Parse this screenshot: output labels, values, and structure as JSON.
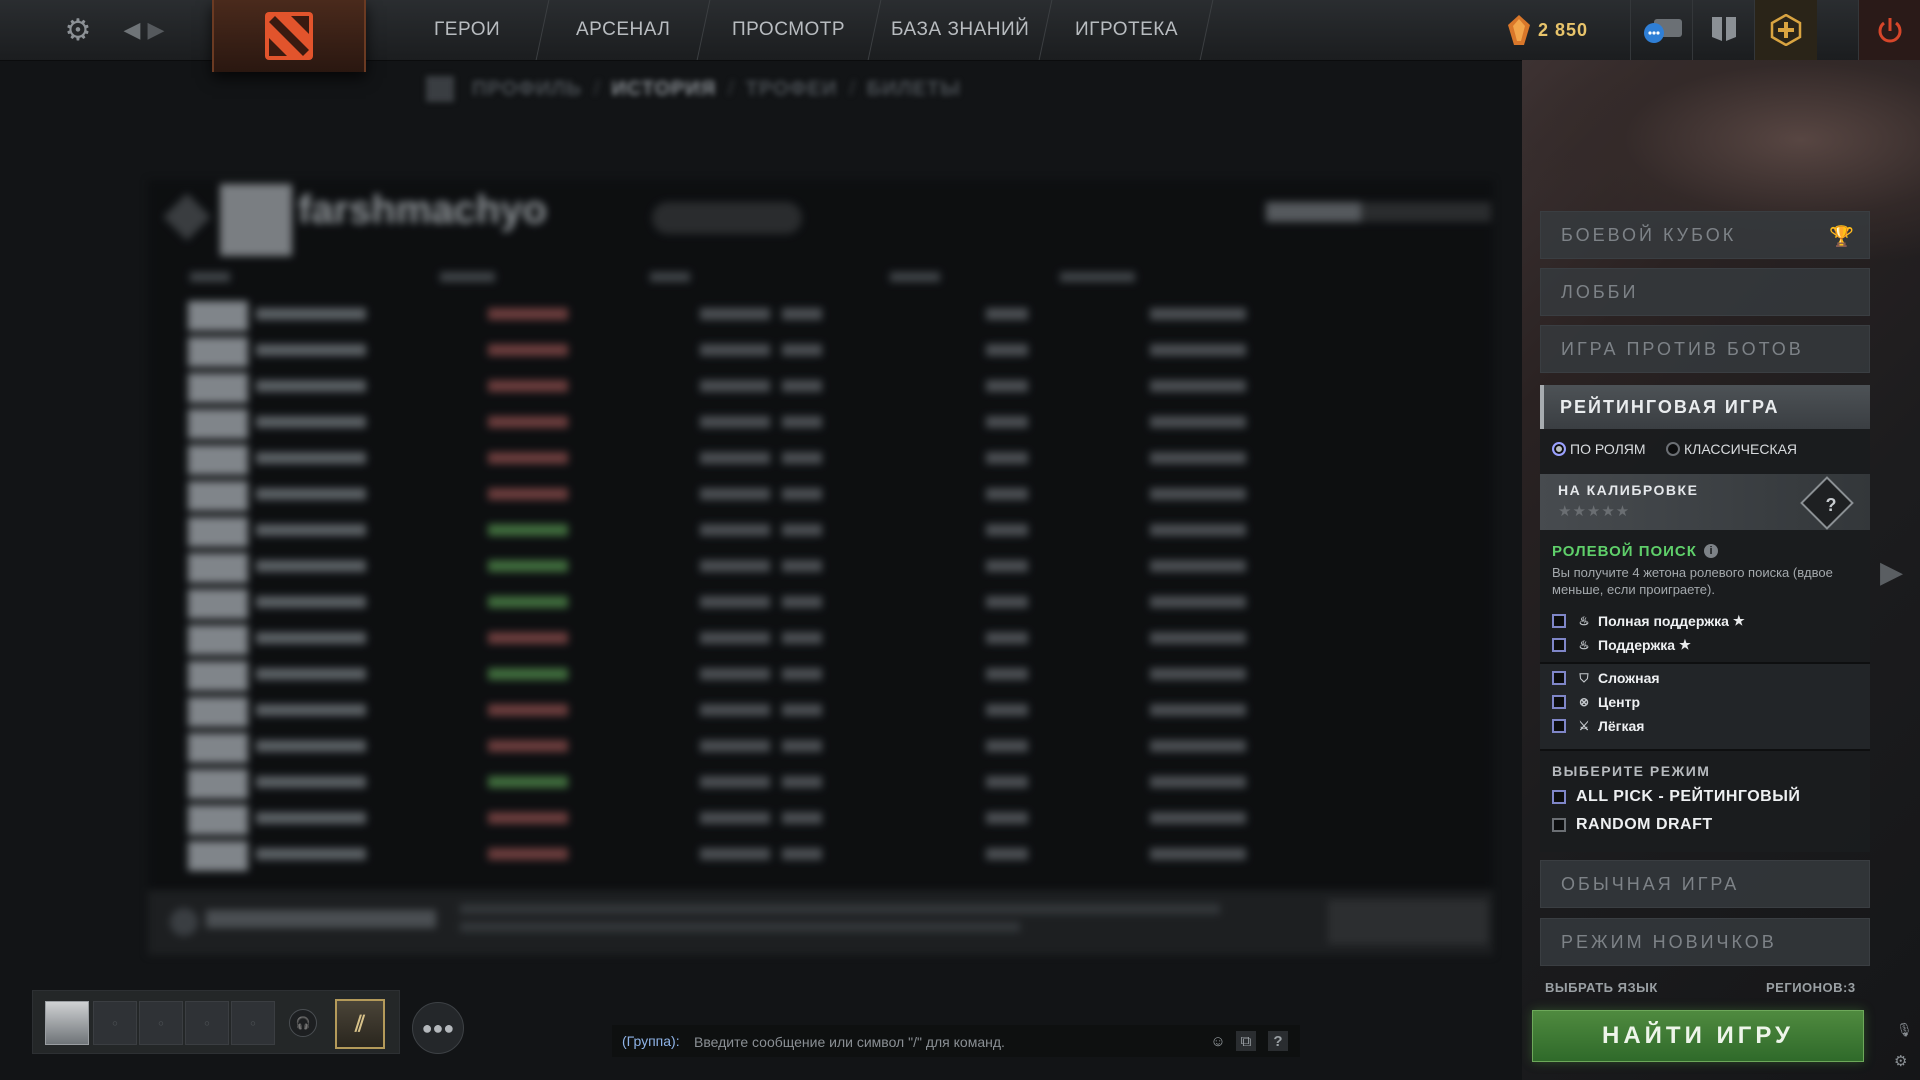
{
  "top_nav": {
    "items": [
      "ГЕРОИ",
      "АРСЕНАЛ",
      "ПРОСМОТР",
      "БАЗА ЗНАНИЙ",
      "ИГРОТЕКА"
    ],
    "shards": "2 850"
  },
  "profile_tabs": [
    "ПРОФИЛЬ",
    "ИСТОРИЯ",
    "ТРОФЕИ",
    "БИЛЕТЫ"
  ],
  "history": {
    "player_name": "farshmachyo"
  },
  "right_panel": {
    "modes_top": [
      "БОЕВОЙ КУБОК",
      "ЛОББИ",
      "ИГРА ПРОТИВ БОТОВ"
    ],
    "ranked": {
      "title": "РЕЙТИНГОВАЯ ИГРА",
      "option_roles": "ПО РОЛЯМ",
      "option_classic": "КЛАССИЧЕСКАЯ",
      "calibration_title": "НА КАЛИБРОВКЕ",
      "calibration_stars": "★★★★★",
      "medal_symbol": "?",
      "role_search_title": "РОЛЕВОЙ ПОИСК",
      "role_search_desc": "Вы получите 4 жетона ролевого поиска (вдвое меньше, если проиграете).",
      "roles_support": [
        {
          "label": "Полная поддержка",
          "icon": "hard-support-icon",
          "star": true
        },
        {
          "label": "Поддержка",
          "icon": "soft-support-icon",
          "star": true
        }
      ],
      "roles_core": [
        {
          "label": "Сложная",
          "icon": "offlane-icon",
          "star": false
        },
        {
          "label": "Центр",
          "icon": "mid-icon",
          "star": false
        },
        {
          "label": "Лёгкая",
          "icon": "safelane-icon",
          "star": false
        }
      ],
      "mode_select_title": "ВЫБЕРИТЕ РЕЖИМ",
      "modes": [
        "ALL PICK - РЕЙТИНГОВЫЙ",
        "RANDOM DRAFT"
      ]
    },
    "modes_bottom": [
      "ОБЫЧНАЯ ИГРА",
      "РЕЖИМ НОВИЧКОВ"
    ],
    "language_button": "ВЫБРАТЬ ЯЗЫК",
    "regions": "РЕГИОНОВ:3",
    "find_game": "НАЙТИ ИГРУ"
  },
  "chat": {
    "channel_label": "(Группа):",
    "placeholder": "Введите сообщение или символ \"/\" для команд.",
    "help": "?"
  },
  "colors": {
    "role_title": "#5fcf6a",
    "find_game": "#3f7a34",
    "chat_label": "#8fb4e8",
    "shards": "#e8c46b"
  }
}
